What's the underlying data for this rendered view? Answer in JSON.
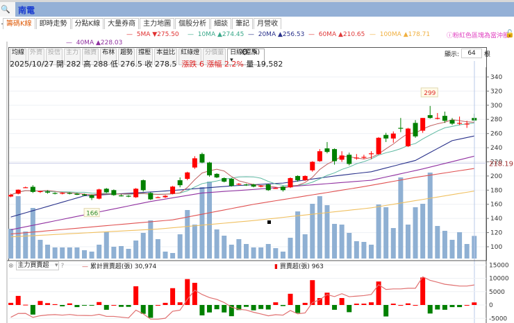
{
  "header": {
    "stock_name": "南電",
    "zoom_icon": "magnifier-plus-icon"
  },
  "tabs": [
    {
      "label": "籌碼K線"
    },
    {
      "label": "即時走勢"
    },
    {
      "label": "分點K線"
    },
    {
      "label": "大量券商"
    },
    {
      "label": "主力地圖"
    },
    {
      "label": "個股分析"
    },
    {
      "label": "細談"
    },
    {
      "label": "筆記"
    },
    {
      "label": "月營收"
    }
  ],
  "ma_legend": [
    {
      "label": "5MA ▼275.50",
      "color": "#e03030"
    },
    {
      "label": "10MA ▲274.45",
      "color": "#3aa88a"
    },
    {
      "label": "20MA ▲256.53",
      "color": "#28308a"
    },
    {
      "label": "60MA ▲210.65",
      "color": "#e03a3a"
    },
    {
      "label": "100MA ▲178.71",
      "color": "#f0b040"
    },
    {
      "label": "40MA ▲228.03",
      "color": "#9030a0"
    }
  ],
  "note": "ⓘ粉紅色區塊為當沖股",
  "toolbar": {
    "buttons": [
      "均線",
      "外資",
      "投信",
      "主力",
      "融資",
      "布林",
      "趨勢",
      "撐壓",
      "本益比",
      "紅綠燈",
      "分價量"
    ],
    "disabled": [
      false,
      true,
      true,
      true,
      true,
      false,
      false,
      false,
      false,
      false,
      true
    ],
    "period": "日線(還原)",
    "show_label": "顯示:",
    "show_value": "64",
    "show_unit": "根"
  },
  "info": {
    "date": "2025/10/27",
    "open": "開 282",
    "high": "高 288",
    "low": "低 276.5",
    "close": "收 278.5",
    "change": "漲跌 6",
    "pct": "漲幅 2.2%",
    "volume": "量 19,582"
  },
  "sub": {
    "indicator": "主力買賣超",
    "help": "?",
    "cum_label": "累計買賣超(張) 30,974",
    "net_label": "買賣超(張) 963"
  },
  "colors": {
    "up": "#ff0000",
    "down": "#008000",
    "volume": "#8fb0d3"
  },
  "chart_data": {
    "type": "candlestick",
    "price_axis": {
      "ticks": [
        100,
        120,
        140,
        160,
        180,
        200,
        220,
        240,
        260,
        280,
        300,
        320,
        340
      ],
      "min": 100,
      "max": 340
    },
    "ref_line": {
      "value": 218.19,
      "label": "218.19"
    },
    "low_marker": {
      "index": 11,
      "label": "166"
    },
    "high_marker": {
      "index": 57,
      "label": "299"
    },
    "ohlc": [
      [
        171,
        175,
        170,
        173.4
      ],
      [
        175,
        181,
        174,
        180.6
      ],
      [
        183.5,
        185,
        183,
        184
      ],
      [
        184.7,
        187,
        176,
        177.5
      ],
      [
        178,
        179,
        176,
        178.5
      ],
      [
        178,
        180,
        175,
        176.5
      ],
      [
        176,
        177,
        174,
        175
      ],
      [
        176,
        177,
        174,
        176
      ],
      [
        176,
        177,
        174,
        175.5
      ],
      [
        175,
        176,
        173,
        173.5
      ],
      [
        174,
        175,
        172,
        172.5
      ],
      [
        173,
        174,
        166,
        169
      ],
      [
        168,
        182,
        167,
        181
      ],
      [
        182,
        183,
        176,
        177
      ],
      [
        180,
        181,
        172,
        173
      ],
      [
        172.5,
        174,
        171,
        172
      ],
      [
        172,
        173,
        170,
        171
      ],
      [
        170,
        183,
        169,
        182
      ],
      [
        194,
        195,
        178,
        180
      ],
      [
        176,
        177,
        166,
        167
      ],
      [
        170,
        171,
        169,
        170
      ],
      [
        170,
        173,
        169,
        172
      ],
      [
        175,
        186,
        174,
        185
      ],
      [
        194,
        198,
        184,
        187
      ],
      [
        196,
        206,
        194,
        205
      ],
      [
        212,
        228,
        210,
        225
      ],
      [
        231,
        233,
        218,
        219
      ],
      [
        219,
        220,
        199,
        201
      ],
      [
        203,
        204,
        197,
        198
      ],
      [
        197,
        198,
        191,
        192
      ],
      [
        196,
        197,
        185,
        186
      ],
      [
        189,
        190,
        187,
        189
      ],
      [
        188,
        189,
        186,
        187.5
      ],
      [
        188,
        189,
        184,
        185
      ],
      [
        186,
        187,
        184,
        186
      ],
      [
        188,
        189,
        179,
        180
      ],
      [
        183,
        184,
        182,
        183
      ],
      [
        185,
        186,
        178,
        180
      ],
      [
        184,
        198,
        183,
        197
      ],
      [
        200,
        201,
        192,
        194
      ],
      [
        194,
        201,
        193,
        200
      ],
      [
        208,
        221,
        206,
        220
      ],
      [
        221,
        238,
        220,
        235
      ],
      [
        239,
        248,
        232,
        234
      ],
      [
        238,
        239,
        216,
        221
      ],
      [
        223,
        235,
        220,
        229
      ],
      [
        230,
        233,
        215,
        217
      ],
      [
        225,
        231,
        223,
        226
      ],
      [
        226,
        230,
        224,
        227
      ],
      [
        232,
        235,
        224,
        232
      ],
      [
        231,
        255,
        230,
        254
      ],
      [
        258,
        261,
        248,
        253
      ],
      [
        253,
        263,
        247,
        260
      ],
      [
        268,
        282,
        262,
        267
      ],
      [
        242,
        268,
        241,
        267
      ],
      [
        275,
        279,
        254,
        256
      ],
      [
        264,
        282,
        261,
        282
      ],
      [
        286,
        299,
        281,
        282
      ],
      [
        282,
        289,
        280,
        282
      ],
      [
        285,
        291,
        275,
        278
      ],
      [
        279,
        282,
        272,
        274
      ],
      [
        275,
        284,
        272,
        275
      ],
      [
        274,
        278,
        268,
        274
      ],
      [
        282,
        288,
        276.5,
        278.5
      ]
    ],
    "volume_k": [
      25.8,
      54,
      23.4,
      43.8,
      16.2,
      12,
      9.6,
      9.6,
      9.6,
      9.6,
      7.2,
      6,
      12,
      23.4,
      10.2,
      10.8,
      8.4,
      15.6,
      22.2,
      33,
      16.8,
      6,
      4.8,
      21,
      42,
      29.4,
      61.8,
      66.6,
      25.2,
      19.8,
      12,
      16.8,
      12.6,
      9.6,
      9.6,
      12.6,
      9,
      6,
      18,
      40.8,
      21,
      47.4,
      54,
      46.2,
      30,
      29.4,
      22.2,
      15,
      14.4,
      12,
      46.8,
      44.4,
      26.4,
      70.2,
      29.4,
      44.4,
      47.4,
      74.4,
      28.2,
      24,
      16.2,
      22.8,
      12.6,
      19.6
    ],
    "ma_points": {
      "20MA": [
        [
          0,
          142
        ],
        [
          10,
          172
        ],
        [
          20,
          178
        ],
        [
          30,
          186
        ],
        [
          37,
          190
        ],
        [
          44,
          200
        ],
        [
          49,
          206
        ],
        [
          55,
          222
        ],
        [
          60,
          250
        ],
        [
          63,
          256.53
        ]
      ],
      "40MA": [
        [
          0,
          124
        ],
        [
          10,
          145
        ],
        [
          19,
          164
        ],
        [
          26,
          176
        ],
        [
          33,
          181
        ],
        [
          49,
          194
        ],
        [
          56,
          210
        ],
        [
          63,
          228.03
        ]
      ],
      "60MA": [
        [
          0,
          118
        ],
        [
          22,
          138
        ],
        [
          33,
          160
        ],
        [
          48,
          185
        ],
        [
          55,
          198
        ],
        [
          63,
          210.65
        ]
      ],
      "100MA": [
        [
          0,
          114
        ],
        [
          20,
          125
        ],
        [
          33,
          137
        ],
        [
          49,
          155
        ],
        [
          63,
          178.71
        ]
      ]
    },
    "sub_axis": {
      "ticks": [
        15000,
        10000,
        5000,
        0,
        -5000
      ]
    },
    "net_buy": [
      800,
      3400,
      100,
      -3600,
      1500,
      700,
      300,
      -500,
      600,
      -800,
      -100,
      -100,
      1100,
      -1800,
      0,
      -700,
      -700,
      7000,
      -3300,
      -4800,
      0,
      800,
      6300,
      1000,
      9700,
      8300,
      -3900,
      -2800,
      -1600,
      -2800,
      -4200,
      -1900,
      -700,
      -2000,
      -1500,
      -1700,
      1000,
      -400,
      4200,
      -3000,
      800,
      9300,
      2600,
      4600,
      -1800,
      2600,
      -2700,
      500,
      500,
      1000,
      8800,
      -4300,
      500,
      0,
      600,
      0,
      10300,
      -3200,
      -1700,
      -1800,
      -800,
      -800,
      0,
      963
    ],
    "cum_line_range": [
      -4600,
      7500
    ]
  }
}
